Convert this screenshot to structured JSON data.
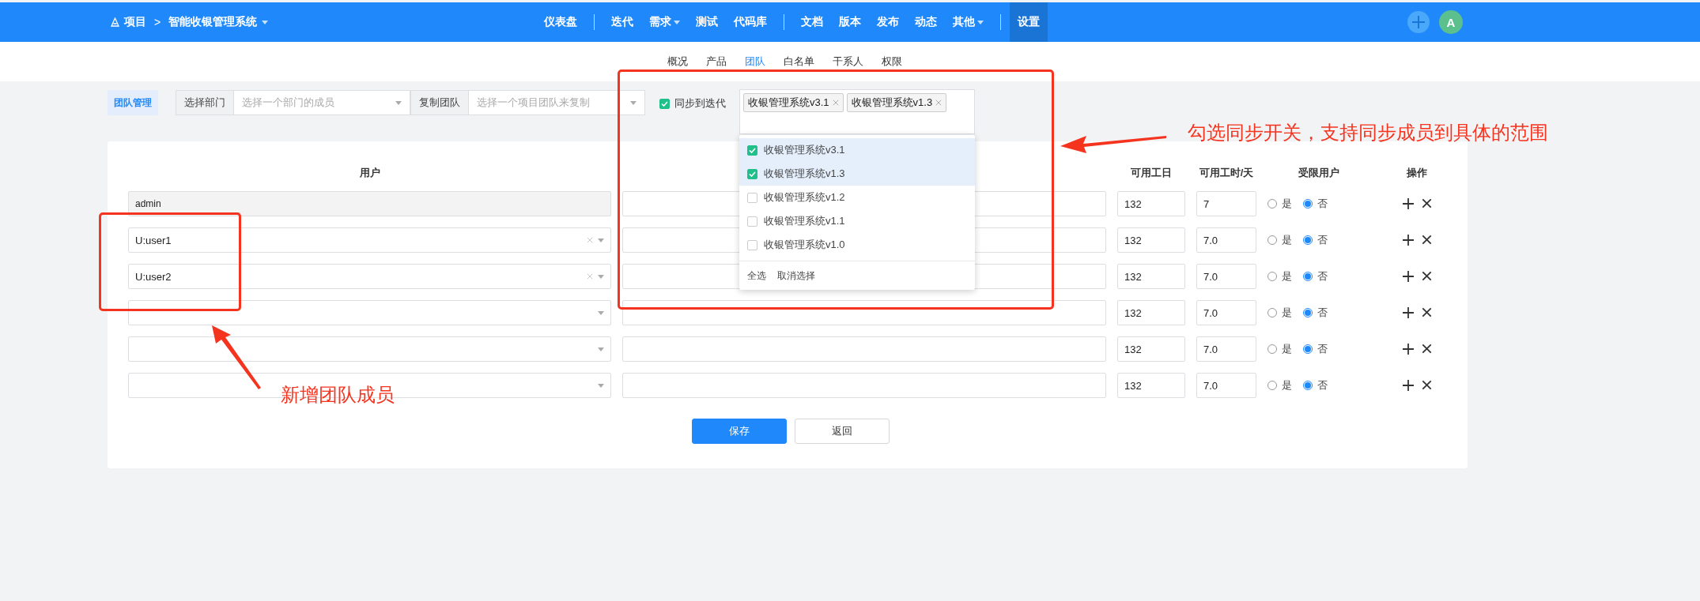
{
  "top_bar": {
    "breadcrumb": {
      "root": "项目",
      "separator": ">",
      "project": "智能收银管理系统",
      "project_has_menu": true
    },
    "nav_groups": [
      [
        {
          "label": "仪表盘",
          "has_menu": false,
          "selected": false
        }
      ],
      [
        {
          "label": "迭代",
          "has_menu": false,
          "selected": false
        },
        {
          "label": "需求",
          "has_menu": true,
          "selected": false
        },
        {
          "label": "测试",
          "has_menu": false,
          "selected": false
        },
        {
          "label": "代码库",
          "has_menu": false,
          "selected": false
        }
      ],
      [
        {
          "label": "文档",
          "has_menu": false,
          "selected": false
        },
        {
          "label": "版本",
          "has_menu": false,
          "selected": false
        },
        {
          "label": "发布",
          "has_menu": false,
          "selected": false
        },
        {
          "label": "动态",
          "has_menu": false,
          "selected": false
        },
        {
          "label": "其他",
          "has_menu": true,
          "selected": false
        }
      ],
      [
        {
          "label": "设置",
          "has_menu": false,
          "selected": true
        }
      ]
    ],
    "avatar": "A"
  },
  "sub_nav": [
    {
      "label": "概况",
      "selected": false
    },
    {
      "label": "产品",
      "selected": false
    },
    {
      "label": "团队",
      "selected": true
    },
    {
      "label": "白名单",
      "selected": false
    },
    {
      "label": "干系人",
      "selected": false
    },
    {
      "label": "权限",
      "selected": false
    }
  ],
  "toolbar": {
    "badge": "团队管理",
    "department": {
      "label": "选择部门",
      "placeholder": "选择一个部门的成员"
    },
    "copy_team": {
      "label": "复制团队",
      "placeholder": "选择一个项目团队来复制"
    },
    "sync": {
      "label": "同步到迭代",
      "checked": true
    },
    "iteration_tags": [
      "收银管理系统v3.1",
      "收银管理系统v1.3"
    ],
    "dropdown": {
      "options": [
        {
          "label": "收银管理系统v3.1",
          "checked": true
        },
        {
          "label": "收银管理系统v1.3",
          "checked": true
        },
        {
          "label": "收银管理系统v1.2",
          "checked": false
        },
        {
          "label": "收银管理系统v1.1",
          "checked": false
        },
        {
          "label": "收银管理系统v1.0",
          "checked": false
        }
      ],
      "select_all": "全选",
      "clear": "取消选择"
    }
  },
  "table": {
    "headers": {
      "user": "用户",
      "days": "可用工日",
      "hours": "可用工时/天",
      "limited": "受限用户",
      "actions": "操作"
    },
    "rows": [
      {
        "kind": "fixed",
        "user": "admin",
        "days": "132",
        "hours": "7",
        "yes_label": "是",
        "no_label": "否",
        "limited": false
      },
      {
        "kind": "select",
        "user": "U:user1",
        "days": "132",
        "hours": "7.0",
        "yes_label": "是",
        "no_label": "否",
        "limited": false
      },
      {
        "kind": "select",
        "user": "U:user2",
        "days": "132",
        "hours": "7.0",
        "yes_label": "是",
        "no_label": "否",
        "limited": false
      },
      {
        "kind": "select",
        "days": "132",
        "hours": "7.0",
        "yes_label": "是",
        "no_label": "否",
        "limited": false
      },
      {
        "kind": "select",
        "days": "132",
        "hours": "7.0",
        "yes_label": "是",
        "no_label": "否",
        "limited": false
      },
      {
        "kind": "select",
        "days": "132",
        "hours": "7.0",
        "yes_label": "是",
        "no_label": "否",
        "limited": false
      }
    ]
  },
  "buttons": [
    {
      "label": "保存",
      "kind": "primary"
    },
    {
      "label": "返回",
      "kind": "default"
    }
  ],
  "annotations": [
    {
      "kind": "sync",
      "text": "勾选同步开关，支持同步成员到具体的范围"
    },
    {
      "kind": "members",
      "text": "新增团队成员"
    }
  ]
}
